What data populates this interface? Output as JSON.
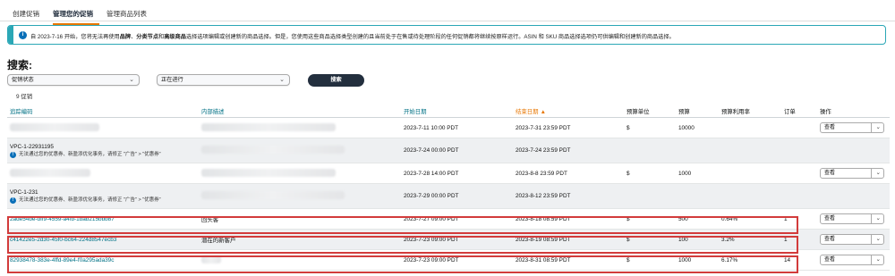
{
  "tabs": [
    {
      "label": "创建促销",
      "active": false
    },
    {
      "label": "管理您的促销",
      "active": true
    },
    {
      "label": "管理商品列表",
      "active": false
    }
  ],
  "notice": {
    "icon": "info-icon",
    "text_before": "自 2023-7-16 开始，您将无法再使用",
    "bold1": "品牌",
    "sep1": "、",
    "bold2": "分类节点",
    "sep2": "和",
    "bold3": "高级商品",
    "text_after": "选择选项编辑或创建新的商品选择。但是，您使用这些商品选择类型创建的且当前处于在售或待处理阶段的任何促销都将继续按原样运行。ASIN 和 SKU 商品选择选项仍可供编辑和创建新的商品选择。"
  },
  "search": {
    "title": "搜索:",
    "status_select": "促销状态",
    "state_select": "正在进行",
    "button": "搜索"
  },
  "count_text": "9 促销",
  "table": {
    "headers": {
      "tracking": "追踪编码",
      "internal": "内部描述",
      "start": "开始日期",
      "end": "结束日期",
      "budget_unit": "预算单位",
      "budget": "预算",
      "utilization": "预算利用率",
      "orders": "订单",
      "action": "操作"
    },
    "sort_arrow": "▲",
    "rows": [
      {
        "tracking": "",
        "internal": "",
        "start": "2023-7-11 10:00 PDT",
        "end": "2023-7-31 23:59 PDT",
        "unit": "$",
        "budget": "10000",
        "util": "",
        "orders": "",
        "action": "查看",
        "gray": false
      },
      {
        "tracking": "VPC-1-22931195",
        "warn": "无法通过您的优惠券、新盈添优化事务，请修正 \"广告\" > \"优惠券\"",
        "internal": "",
        "start": "2023-7-24 00:00 PDT",
        "end": "2023-7-24 23:59 PDT",
        "unit": "",
        "budget": "",
        "util": "",
        "orders": "",
        "action": "",
        "gray": true
      },
      {
        "tracking": "",
        "internal": "",
        "start": "2023-7-28 14:00 PDT",
        "end": "2023-8-8 23:59 PDT",
        "unit": "$",
        "budget": "1000",
        "util": "",
        "orders": "",
        "action": "查看",
        "gray": false
      },
      {
        "tracking": "VPC-1-231",
        "warn": "无法通过您的优惠券、新盈添优化事务，请修正 \"广告\" > \"优惠券\"",
        "internal": "",
        "start": "2023-7-29 00:00 PDT",
        "end": "2023-8-12 23:59 PDT",
        "unit": "",
        "budget": "",
        "util": "",
        "orders": "",
        "action": "",
        "gray": true
      },
      {
        "tracking": "2ade54be-dff9-4559-a4fb-1bab215bbb87",
        "internal": "回头客",
        "start": "2023-7-27 09:00 PDT",
        "end": "2023-8-18 08:59 PDT",
        "unit": "$",
        "budget": "500",
        "util": "0.64%",
        "orders": "1",
        "action": "查看",
        "gray": false
      },
      {
        "tracking": "c41422e5-2d30-45f0-bc64-224d8547ecb3",
        "internal": "潜在的新客户",
        "start": "2023-7-23 09:00 PDT",
        "end": "2023-8-19 08:59 PDT",
        "unit": "$",
        "budget": "100",
        "util": "3.2%",
        "orders": "1",
        "action": "查看",
        "gray": true
      },
      {
        "tracking": "82938478-383e-4ffd-89e4-f0a295ada39c",
        "internal": "",
        "start": "2023-7-23 09:00 PDT",
        "end": "2023-8-31 08:59 PDT",
        "unit": "$",
        "budget": "1000",
        "util": "6.17%",
        "orders": "14",
        "action": "查看",
        "gray": false
      }
    ]
  },
  "colors": {
    "highlight": "#d23b3b",
    "accent": "#e77600",
    "link": "#007185",
    "notice": "#2ba7b6"
  }
}
